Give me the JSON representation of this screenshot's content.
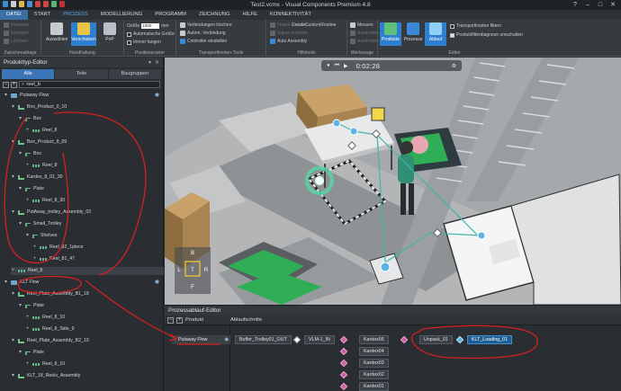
{
  "window": {
    "title": "Test2.vcmx - Visual Components Premium 4.8"
  },
  "menu": {
    "tabs": [
      "DATEI",
      "START",
      "PROZESS",
      "MODELLIERUNG",
      "PROGRAMM",
      "ZEICHNUNG",
      "HILFE",
      "KONNEKTIVITÄT"
    ],
    "active": "DATEI"
  },
  "ribbon": {
    "clipboard": {
      "items": [
        "Kopieren",
        "Einfügen",
        "Löschen"
      ],
      "label": "Zwischenablage"
    },
    "handling": {
      "select": "Auswählen",
      "move": "Verschieben",
      "pnp": "PnP",
      "label": "Handhabung"
    },
    "grid": {
      "size_label": "Größe",
      "size_value": "1000",
      "unit": "mm",
      "auto": "Automatische Größe",
      "always": "Immer fangen",
      "label": "Positionsraster"
    },
    "tools": {
      "items": [
        "Verbindungen löschen",
        "Autom. Verbindung",
        "Controller einstellen"
      ],
      "label": "Transportknoten-Tools"
    },
    "help": {
      "items": [
        "Frame erstellen",
        "Signal erstellen",
        "Auto Assembly"
      ],
      "custom": "CreateCustomRoutine",
      "label": "Hilfstools"
    },
    "tools2": {
      "items": [
        "Messen",
        "Ausrichten",
        "Ausrichten"
      ],
      "label": "Werkzeuge"
    },
    "editor": {
      "buttons": [
        "Produkte",
        "Prozesse",
        "Ablauf"
      ],
      "filter_nodes": "Transportknoten filtern",
      "filter_diag": "Produktfilterdiagnose umschalten",
      "label": "Editor"
    }
  },
  "left_panel": {
    "title": "Produkttyp-Editor",
    "tabs": [
      "Alle",
      "Teile",
      "Baugruppen"
    ],
    "search_value": "reel_b",
    "tree": [
      {
        "label": "Putaway Flow",
        "level": 0,
        "type": "flow"
      },
      {
        "label": "Box_Product_0_10",
        "level": 1,
        "type": "prod"
      },
      {
        "label": "Box",
        "level": 2,
        "type": "part"
      },
      {
        "label": "Reel_8",
        "level": 3,
        "type": "reel"
      },
      {
        "label": "Box_Product_8_09",
        "level": 1,
        "type": "prod"
      },
      {
        "label": "Box",
        "level": 2,
        "type": "part"
      },
      {
        "label": "Reel_8",
        "level": 3,
        "type": "reel"
      },
      {
        "label": "Kardex_8_01_30",
        "level": 1,
        "type": "prod"
      },
      {
        "label": "Plate",
        "level": 2,
        "type": "part"
      },
      {
        "label": "Reel_8_30",
        "level": 3,
        "type": "reel"
      },
      {
        "label": "PutAway_trolley_Assembly_02",
        "level": 1,
        "type": "prod"
      },
      {
        "label": "Small_Trolley",
        "level": 2,
        "type": "part"
      },
      {
        "label": "Shelves",
        "level": 3,
        "type": "part"
      },
      {
        "label": "Reel_82_1piece",
        "level": 4,
        "type": "reel"
      },
      {
        "label": "Reel_81_47",
        "level": 4,
        "type": "reel"
      },
      {
        "label": "Reel_8",
        "level": 1,
        "type": "reel"
      },
      {
        "label": "KLT Flow",
        "level": 0,
        "type": "flow"
      },
      {
        "label": "Reel_Plate_Assembly_B1_19",
        "level": 1,
        "type": "prod"
      },
      {
        "label": "Plate",
        "level": 2,
        "type": "part"
      },
      {
        "label": "Reel_8_10",
        "level": 3,
        "type": "reel"
      },
      {
        "label": "Reel_8_Side_9",
        "level": 3,
        "type": "reel"
      },
      {
        "label": "Reel_Plate_Assembly_B2_10",
        "level": 1,
        "type": "prod"
      },
      {
        "label": "Plate",
        "level": 2,
        "type": "part"
      },
      {
        "label": "Reel_8_10",
        "level": 3,
        "type": "reel"
      },
      {
        "label": "KLT_18_Reels_Assembly",
        "level": 1,
        "type": "prod"
      }
    ]
  },
  "viewport": {
    "time": "0:02:28",
    "navcube": {
      "top": "B",
      "left": "L",
      "center": "T",
      "right": "R",
      "bottom": "F"
    }
  },
  "process_editor": {
    "title": "Prozessablauf-Editor",
    "col_product": "Produkt",
    "col_steps": "Ablaufschritte",
    "flow_name": "Putaway Flow",
    "steps": [
      "Buffer_Trolley01_OUT",
      "VLM-1_IN",
      "Kardex05",
      "Kardex04",
      "Kardex03",
      "Kardex02",
      "Kardex01",
      "Unpack_01",
      "KLT_Loading_01"
    ]
  },
  "colors": {
    "accent": "#2f7fd1",
    "annotation": "#d32020",
    "green": "#2fae55"
  }
}
